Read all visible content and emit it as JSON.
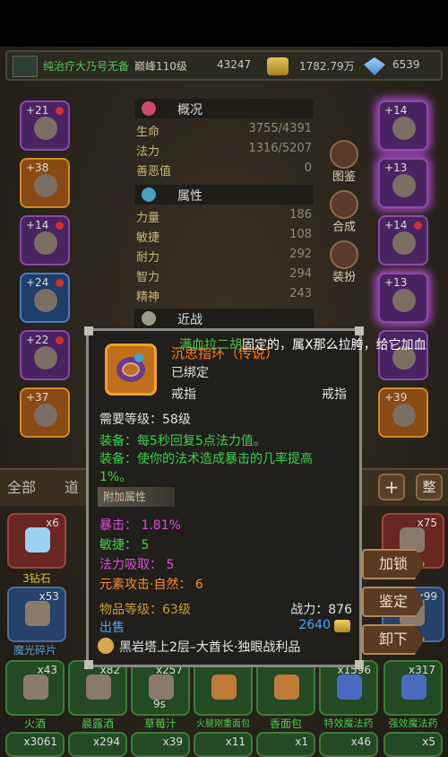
{
  "status": {
    "player_name": "纯治疗大乃号无备",
    "level": "巅峰110级",
    "exp": "43247",
    "gold": "1782.79万",
    "diamond": "6539"
  },
  "stats": {
    "overview_title": "概况",
    "life_label": "生命",
    "life_value": "3755/4391",
    "mana_label": "法力",
    "mana_value": "1316/5207",
    "karma_label": "善恶值",
    "karma_value": "0",
    "attr_title": "属性",
    "str_label": "力量",
    "str_value": "186",
    "agi_label": "敏捷",
    "agi_value": "108",
    "sta_label": "耐力",
    "sta_value": "292",
    "int_label": "智力",
    "int_value": "294",
    "spi_label": "精神",
    "spi_value": "243",
    "melee_title": "近战"
  },
  "side_buttons": [
    "图鉴",
    "合成",
    "装扮"
  ],
  "slots_left": [
    "+21",
    "+38",
    "+14",
    "+24",
    "+22",
    "+37"
  ],
  "slots_right": [
    "+14",
    "+13",
    "+14",
    "+13",
    "",
    "+39"
  ],
  "notice": {
    "name": "满血拉二胡",
    "text": "固定的，属X那么拉胯，给它加血"
  },
  "inventory": {
    "tab_all": "全部",
    "tab_prop": "道",
    "plus": "+",
    "sort": "整",
    "row1": [
      {
        "count": "x6",
        "name": "3钻石"
      },
      {
        "count": "x75",
        "name": ""
      }
    ],
    "row2": [
      {
        "count": "x53",
        "name": "魔光碎片"
      },
      {
        "count": "x99",
        "name": ""
      }
    ],
    "row3": [
      {
        "count": "x43",
        "name": "火酒"
      },
      {
        "count": "x82",
        "name": "晨露酒"
      },
      {
        "count": "x257",
        "name": "草莓汁"
      },
      {
        "count": "",
        "name": "火腿刚重面包"
      },
      {
        "count": "",
        "name": "香面包"
      },
      {
        "count": "x1596",
        "name": "特效魔法药"
      },
      {
        "count": "x317",
        "name": "强效魔法药"
      }
    ],
    "row4": [
      "x3061",
      "x294",
      "x39",
      "x11",
      "x1",
      "x46",
      "x5"
    ],
    "timer": "9s"
  },
  "actions": {
    "lock": "加锁",
    "identify": "鉴定",
    "unequip": "卸下"
  },
  "tooltip": {
    "name": "沉思指环（传说）",
    "bound": "已绑定",
    "type": "戒指",
    "slot": "戒指",
    "require": "需要等级：58级",
    "effect1": "装备：每5秒回复5点法力值。",
    "effect2a": "装备：使你的法术造成暴击的几率提高",
    "effect2b": "1%。",
    "banner": "附加属性",
    "crit_label": "暴击：",
    "crit_value": "1.81%",
    "agi_label": "敏捷：",
    "agi_value": "5",
    "leech_label": "法力吸取：",
    "leech_value": "5",
    "elem_label": "元素攻击·自然：",
    "elem_value": "6",
    "item_level": "物品等级：63级",
    "power": "战力：876",
    "sell": "出售",
    "price": "2640",
    "source": "黑岩塔上2层–大酋长·独眼战利品"
  },
  "colors": {
    "legendary": "#ff7a1e",
    "green_effect": "#3bd04a",
    "crit": "#e04ae0",
    "agi": "#4ad04a",
    "leech": "#e04ae0",
    "elem": "#ff8a2a",
    "sell": "#4aa0ff"
  }
}
